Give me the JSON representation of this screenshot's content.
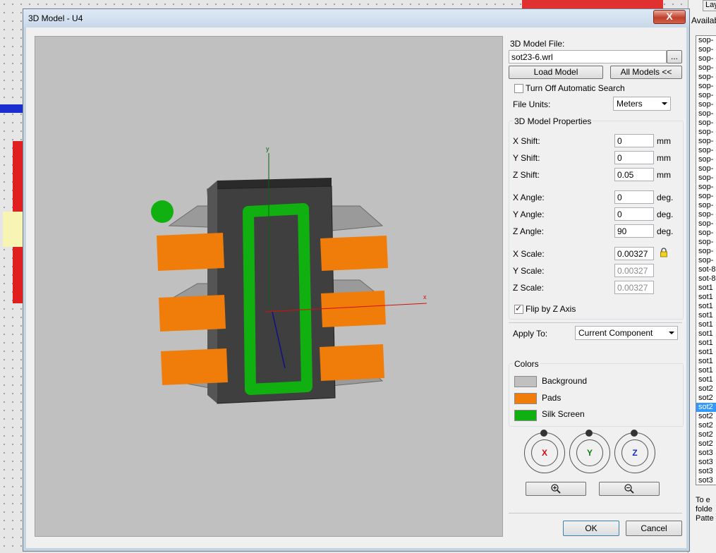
{
  "dialog": {
    "title": "3D Model - U4",
    "close_label": "X"
  },
  "model_file": {
    "label": "3D Model File:",
    "value": "sot23-6.wrl",
    "browse_label": "...",
    "load_label": "Load Model",
    "all_models_label": "All Models <<"
  },
  "auto_search": {
    "label": "Turn Off Automatic Search",
    "checked": false
  },
  "file_units": {
    "label": "File Units:",
    "value": "Meters"
  },
  "properties": {
    "group_label": "3D Model Properties",
    "x_shift": {
      "label": "X Shift:",
      "value": "0",
      "unit": "mm"
    },
    "y_shift": {
      "label": "Y Shift:",
      "value": "0",
      "unit": "mm"
    },
    "z_shift": {
      "label": "Z Shift:",
      "value": "0.05",
      "unit": "mm"
    },
    "x_angle": {
      "label": "X Angle:",
      "value": "0",
      "unit": "deg."
    },
    "y_angle": {
      "label": "Y Angle:",
      "value": "0",
      "unit": "deg."
    },
    "z_angle": {
      "label": "Z Angle:",
      "value": "90",
      "unit": "deg."
    },
    "x_scale": {
      "label": "X Scale:",
      "value": "0.00327"
    },
    "y_scale": {
      "label": "Y Scale:",
      "value": "0.00327"
    },
    "z_scale": {
      "label": "Z Scale:",
      "value": "0.00327"
    },
    "flip_label": "Flip by Z Axis",
    "flip_checked": true
  },
  "apply_to": {
    "label": "Apply To:",
    "value": "Current Component"
  },
  "colors": {
    "group_label": "Colors",
    "items": [
      {
        "label": "Background",
        "color": "#c0c0c0"
      },
      {
        "label": "Pads",
        "color": "#f07c0a"
      },
      {
        "label": "Silk Screen",
        "color": "#10b010"
      }
    ]
  },
  "rotate": {
    "x_label": "X",
    "y_label": "Y",
    "z_label": "Z",
    "x_color": "#d01010",
    "y_color": "#108010",
    "z_color": "#1030c0"
  },
  "buttons": {
    "ok_label": "OK",
    "cancel_label": "Cancel"
  },
  "background_panel": {
    "header": "Availab",
    "tab": "Lay",
    "list_items": [
      "sop-",
      "sop-",
      "sop-",
      "sop-",
      "sop-",
      "sop-",
      "sop-",
      "sop-",
      "sop-",
      "sop-",
      "sop-",
      "sop-",
      "sop-",
      "sop-",
      "sop-",
      "sop-",
      "sop-",
      "sop-",
      "sop-",
      "sop-",
      "sop-",
      "sop-",
      "sop-",
      "sop-",
      "sop-",
      "sot-8",
      "sot-8",
      "sot1",
      "sot1",
      "sot1",
      "sot1",
      "sot1",
      "sot1",
      "sot1",
      "sot1",
      "sot1",
      "sot1",
      "sot1",
      "sot2",
      "sot2",
      "sot2",
      "sot2",
      "sot2",
      "sot2",
      "sot2",
      "sot3",
      "sot3",
      "sot3",
      "sot3",
      "sot3"
    ],
    "selected_index": 40,
    "note_lines": [
      "To e",
      "folde",
      "Patte"
    ]
  },
  "viewport": {
    "axis_x_label": "x",
    "axis_y_label": "y"
  }
}
